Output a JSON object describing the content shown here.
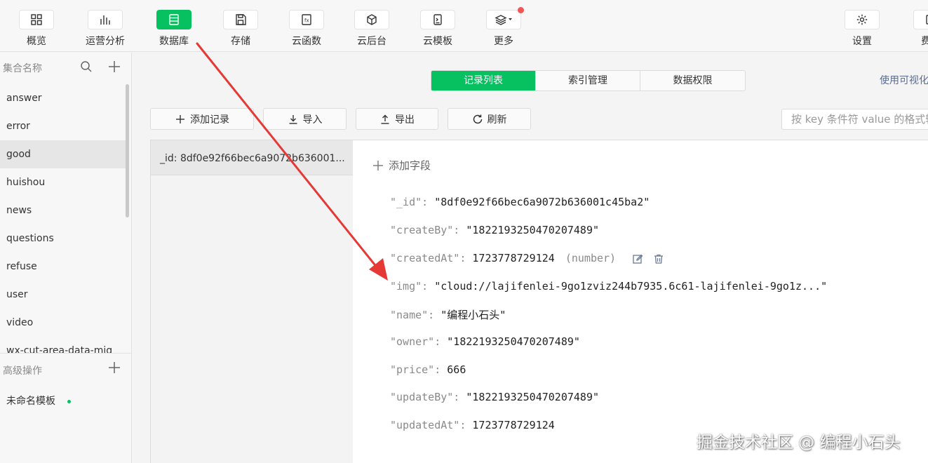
{
  "colors": {
    "accent": "#07c160",
    "arrow": "#e53935",
    "link": "#576b95"
  },
  "toolbar": {
    "items": [
      {
        "label": "概览",
        "icon": "grid-icon"
      },
      {
        "label": "运营分析",
        "icon": "bar-chart-icon"
      },
      {
        "label": "数据库",
        "icon": "database-icon",
        "active": true
      },
      {
        "label": "存储",
        "icon": "save-icon"
      },
      {
        "label": "云函数",
        "icon": "function-icon"
      },
      {
        "label": "云后台",
        "icon": "cube-icon"
      },
      {
        "label": "云模板",
        "icon": "template-icon"
      },
      {
        "label": "更多",
        "icon": "layers-icon"
      },
      {
        "label": "设置",
        "icon": "gear-icon"
      },
      {
        "label": "费用",
        "icon": "cost-icon"
      }
    ]
  },
  "sidebar": {
    "header": "集合名称",
    "collections": [
      "answer",
      "error",
      "good",
      "huishou",
      "news",
      "questions",
      "refuse",
      "user",
      "video",
      "wx-cut-area-data-mig"
    ],
    "selected": "good",
    "advanced_header": "高级操作",
    "template_item": "未命名模板"
  },
  "tabs": [
    "记录列表",
    "索引管理",
    "数据权限"
  ],
  "visual_link": "使用可视化",
  "actions": {
    "add": "添加记录",
    "import": "导入",
    "export": "导出",
    "refresh": "刷新"
  },
  "filter": {
    "placeholder": "按 key 条件符 value 的格式输入"
  },
  "records": [
    "_id: 8df0e92f66bec6a9072b636001..."
  ],
  "detail": {
    "add_field": "添加字段",
    "fields": [
      {
        "key": "\"_id\":",
        "value": "\"8df0e92f66bec6a9072b636001c45ba2\""
      },
      {
        "key": "\"createBy\":",
        "value": "\"1822193250470207489\""
      },
      {
        "key": "\"createdAt\":",
        "value": "1723778729124",
        "type": "(number)"
      },
      {
        "key": "\"img\":",
        "value": "\"cloud://lajifenlei-9go1zviz244b7935.6c61-lajifenlei-9go1z...\""
      },
      {
        "key": "\"name\":",
        "value": "\"编程小石头\""
      },
      {
        "key": "\"owner\":",
        "value": "\"1822193250470207489\""
      },
      {
        "key": "\"price\":",
        "value": "666"
      },
      {
        "key": "\"updateBy\":",
        "value": "\"1822193250470207489\""
      },
      {
        "key": "\"updatedAt\":",
        "value": "1723778729124"
      }
    ]
  },
  "watermark": "掘金技术社区 @ 编程小石头"
}
